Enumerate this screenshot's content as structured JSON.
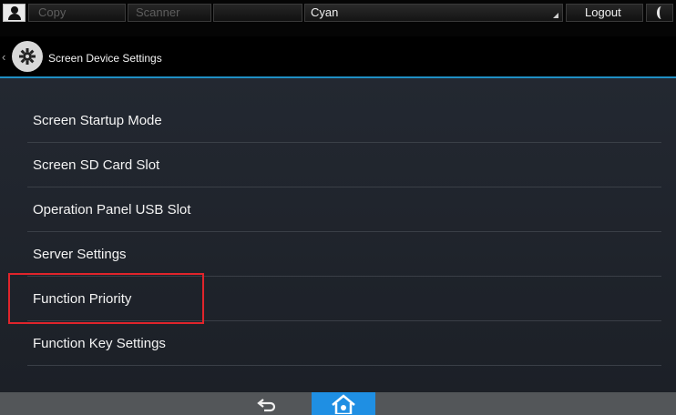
{
  "topbar": {
    "copy_label": "Copy",
    "scanner_label": "Scanner",
    "user_field": "Cyan",
    "logout_label": "Logout"
  },
  "header": {
    "title": "Screen Device Settings",
    "back_glyph": "‹"
  },
  "menu": {
    "items": [
      {
        "label": "Screen Startup Mode"
      },
      {
        "label": "Screen SD Card Slot"
      },
      {
        "label": "Operation Panel USB Slot"
      },
      {
        "label": "Server Settings"
      },
      {
        "label": "Function Priority"
      },
      {
        "label": "Function Key Settings"
      }
    ]
  },
  "colors": {
    "accent": "#1f8fe3",
    "highlight_box": "#e0242b"
  },
  "icons": {
    "user": "user-icon",
    "moon": "energy-saver-moon-icon",
    "gear": "gear-icon",
    "back": "back-arrow-icon",
    "home": "home-icon"
  }
}
